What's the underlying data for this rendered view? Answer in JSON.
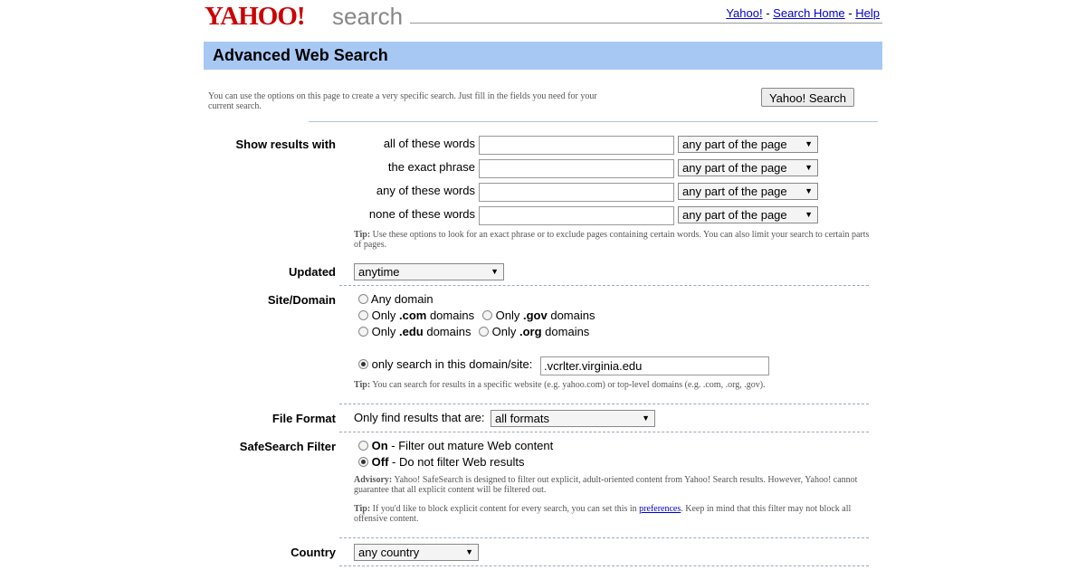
{
  "header": {
    "logo_text": "YAHOO!",
    "logo_search_text": "search",
    "links": [
      "Yahoo!",
      "Search Home",
      "Help"
    ],
    "link_separator": "-"
  },
  "title": "Advanced Web Search",
  "intro": "You can use the options on this page to create a very specific search. Just fill in the fields you need for your current search.",
  "search_button": "Yahoo! Search",
  "show_results": {
    "label": "Show results with",
    "rows": [
      {
        "label": "all of these words",
        "value": "",
        "scope": "any part of the page"
      },
      {
        "label": "the exact phrase",
        "value": "",
        "scope": "any part of the page"
      },
      {
        "label": "any of these words",
        "value": "",
        "scope": "any part of the page"
      },
      {
        "label": "none of these words",
        "value": "",
        "scope": "any part of the page"
      }
    ],
    "tip_label": "Tip:",
    "tip": "Use these options to look for an exact phrase or to exclude pages containing certain words. You can also limit your search to certain parts of pages."
  },
  "updated": {
    "label": "Updated",
    "value": "anytime"
  },
  "site_domain": {
    "label": "Site/Domain",
    "any": "Any domain",
    "only": "Only",
    "domains": "domains",
    "com": ".com",
    "gov": ".gov",
    "edu": ".edu",
    "org": ".org",
    "only_site_label": "only search in this domain/site:",
    "only_site_value": ".vcrlter.virginia.edu",
    "selected": "only_site",
    "tip_label": "Tip:",
    "tip": "You can search for results in a specific website (e.g. yahoo.com) or top-level domains (e.g. .com, .org, .gov)."
  },
  "file_format": {
    "label": "File Format",
    "prompt": "Only find results that are:",
    "value": "all formats"
  },
  "safesearch": {
    "label": "SafeSearch Filter",
    "on_label": "On",
    "on_desc": " - Filter out mature Web content",
    "off_label": "Off",
    "off_desc": " - Do not filter Web results",
    "selected": "off",
    "advisory_label": "Advisory:",
    "advisory": "Yahoo! SafeSearch is designed to filter out explicit, adult-oriented content from Yahoo! Search results. However, Yahoo! cannot guarantee that all explicit content will be filtered out.",
    "tip_label": "Tip:",
    "tip_before": "If you'd like to block explicit content for every search, you can set this in",
    "tip_link": "preferences",
    "tip_after": ". Keep in mind that this filter may not block all offensive content."
  },
  "country": {
    "label": "Country",
    "value": "any country"
  },
  "colors": {
    "title_bar": "#a8c8f4",
    "logo_red": "#cc0000",
    "link": "#0000cc"
  }
}
